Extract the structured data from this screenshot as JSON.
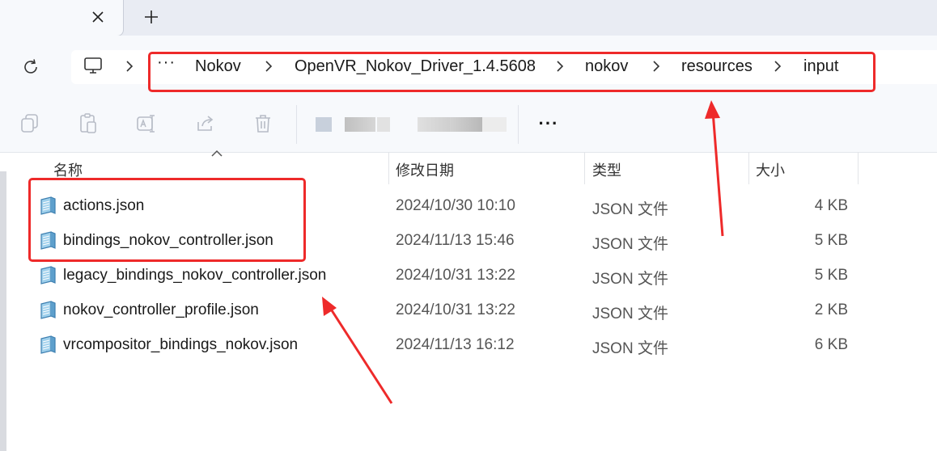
{
  "tabs": {
    "close_glyph": "✕",
    "new_tab_glyph": "+"
  },
  "address_bar": {
    "overflow": "···",
    "crumbs": [
      "Nokov",
      "OpenVR_Nokov_Driver_1.4.5608",
      "nokov",
      "resources",
      "input"
    ]
  },
  "toolbar": {
    "more": "···"
  },
  "columns": {
    "name": "名称",
    "modified": "修改日期",
    "type": "类型",
    "size": "大小"
  },
  "files": [
    {
      "name": "actions.json",
      "modified": "2024/10/30 10:10",
      "type": "JSON 文件",
      "size": "4 KB"
    },
    {
      "name": "bindings_nokov_controller.json",
      "modified": "2024/11/13 15:46",
      "type": "JSON 文件",
      "size": "5 KB"
    },
    {
      "name": "legacy_bindings_nokov_controller.json",
      "modified": "2024/10/31 13:22",
      "type": "JSON 文件",
      "size": "5 KB"
    },
    {
      "name": "nokov_controller_profile.json",
      "modified": "2024/10/31 13:22",
      "type": "JSON 文件",
      "size": "2 KB"
    },
    {
      "name": "vrcompositor_bindings_nokov.json",
      "modified": "2024/11/13 16:12",
      "type": "JSON 文件",
      "size": "6 KB"
    }
  ],
  "colors": {
    "annotation_red": "#ee2a2a",
    "chrome_bg": "#f7f9fc",
    "tab_strip_bg": "#e9ecf3"
  },
  "icons": [
    "close-icon",
    "plus-icon",
    "refresh-icon",
    "this-pc-icon",
    "chevron-right-icon",
    "copy-icon",
    "paste-icon",
    "rename-icon",
    "share-icon",
    "delete-icon",
    "json-file-icon"
  ]
}
